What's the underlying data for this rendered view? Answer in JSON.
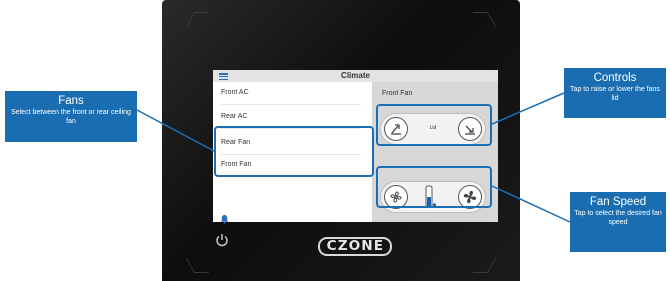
{
  "screen": {
    "title": "Climate",
    "list_items": [
      {
        "label": "Front AC",
        "selected": false
      },
      {
        "label": "Rear AC",
        "selected": false
      },
      {
        "label": "Rear Fan",
        "selected": false
      },
      {
        "label": "Front Fan",
        "selected": true
      }
    ],
    "panel_title": "Front Fan",
    "lid_label": "Lid"
  },
  "brand": "CZONE",
  "callouts": {
    "fans": {
      "title": "Fans",
      "desc": "Select between the front or rear ceiling fan"
    },
    "controls": {
      "title": "Controls",
      "desc": "Tap to raise or lower the fans lid"
    },
    "fan_speed": {
      "title": "Fan Speed",
      "desc": "Tap to select the desired fan speed"
    }
  },
  "colors": {
    "accent": "#1a6db0",
    "highlight": "#1b6fb5"
  }
}
